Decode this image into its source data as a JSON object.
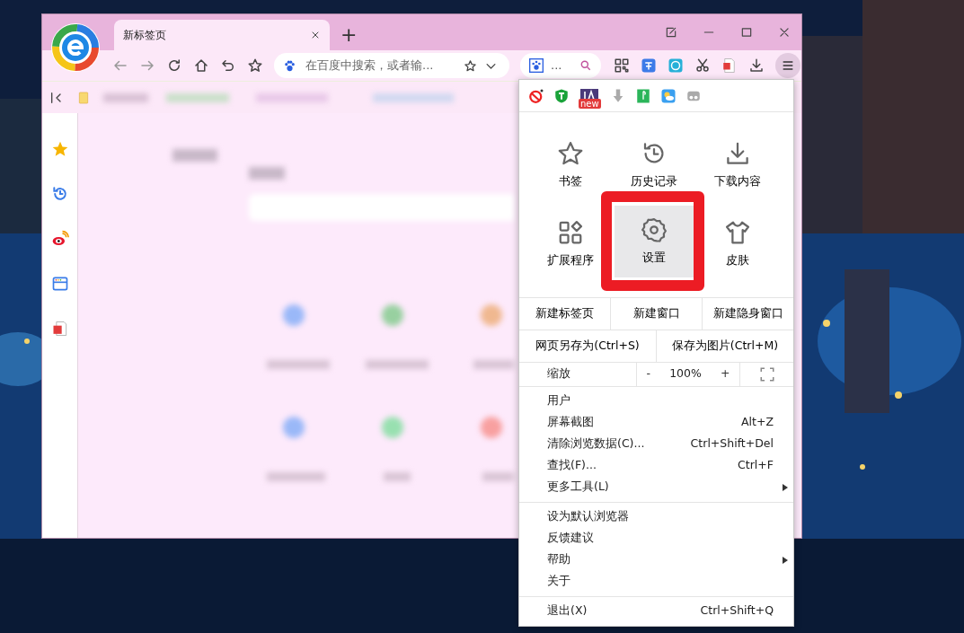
{
  "tabs": [
    {
      "label": "新标签页",
      "selected": true
    }
  ],
  "new_tab_button": "+",
  "address_bar": {
    "placeholder": "在百度中搜索，或者输..."
  },
  "search_box": {
    "text": "..."
  },
  "menu": {
    "extension_badge": "new",
    "tiles": [
      {
        "label": "书签",
        "kind": "star",
        "highlighted": false
      },
      {
        "label": "历史记录",
        "kind": "history",
        "highlighted": false
      },
      {
        "label": "下载内容",
        "kind": "download",
        "highlighted": false
      },
      {
        "label": "扩展程序",
        "kind": "apps",
        "highlighted": false
      },
      {
        "label": "设置",
        "kind": "gear",
        "highlighted": true
      },
      {
        "label": "皮肤",
        "kind": "shirt",
        "highlighted": false
      }
    ],
    "window_row": [
      "新建标签页",
      "新建窗口",
      "新建隐身窗口"
    ],
    "save_row": [
      "网页另存为(Ctrl+S)",
      "保存为图片(Ctrl+M)"
    ],
    "zoom": {
      "label": "缩放",
      "minus": "-",
      "value": "100%",
      "plus": "+"
    },
    "groups": [
      [
        {
          "label": "用户"
        },
        {
          "label": "屏幕截图",
          "shortcut": "Alt+Z"
        },
        {
          "label": "清除浏览数据(C)...",
          "shortcut": "Ctrl+Shift+Del"
        },
        {
          "label": "查找(F)...",
          "shortcut": "Ctrl+F"
        },
        {
          "label": "更多工具(L)",
          "submenu": true
        }
      ],
      [
        {
          "label": "设为默认浏览器"
        },
        {
          "label": "反馈建议"
        },
        {
          "label": "帮助",
          "submenu": true
        },
        {
          "label": "关于"
        }
      ],
      [
        {
          "label": "退出(X)",
          "shortcut": "Ctrl+Shift+Q"
        }
      ]
    ]
  }
}
